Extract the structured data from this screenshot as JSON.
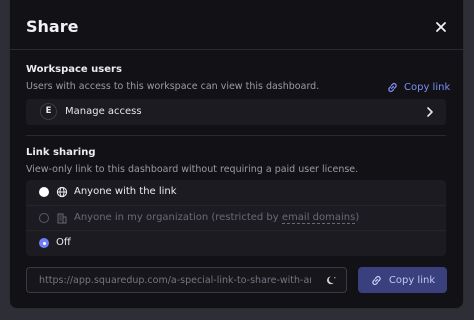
{
  "modal": {
    "title": "Share"
  },
  "workspace": {
    "title": "Workspace users",
    "description": "Users with access to this workspace can view this dashboard.",
    "copy_link_label": "Copy link",
    "manage": {
      "avatar_letter": "E",
      "label": "Manage access"
    }
  },
  "sharing": {
    "title": "Link sharing",
    "description": "View-only link to this dashboard without requiring a paid user license.",
    "options": [
      {
        "label": "Anyone with the link",
        "icon": "globe-icon",
        "state": "selected-white",
        "disabled": false
      },
      {
        "label_prefix": "Anyone in my organization (restricted by ",
        "label_link": "email domains",
        "label_suffix": ")",
        "icon": "building-icon",
        "state": "unselected",
        "disabled": true
      },
      {
        "label": "Off",
        "icon": "",
        "state": "selected",
        "disabled": false
      }
    ],
    "link_value": "https://app.squaredup.com/a-special-link-to-share-with-anyone",
    "copy_button_label": "Copy link"
  },
  "colors": {
    "accent": "#6f7ff7",
    "copy_link_text": "#7d8cf5",
    "copy_button_bg": "#3a3f7d",
    "modal_bg": "#121216",
    "row_bg": "#1b1b21"
  }
}
